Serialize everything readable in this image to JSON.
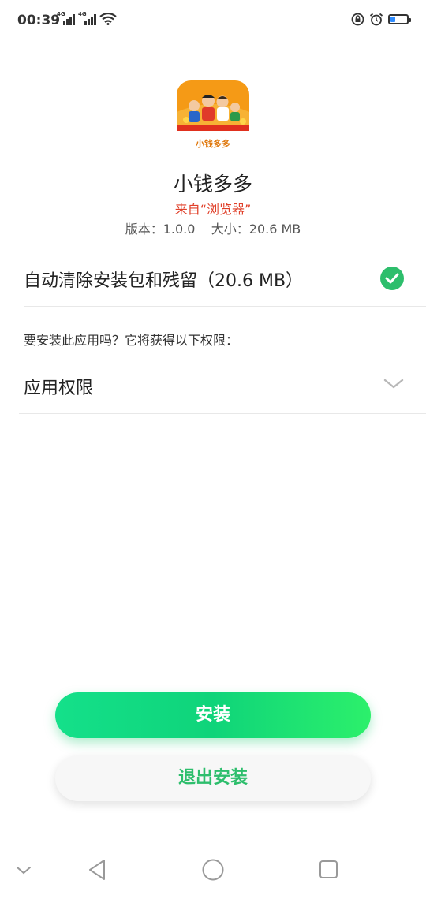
{
  "status_bar": {
    "time": "00:39",
    "network_1": "4G",
    "network_2": "4G",
    "battery_level": 0.3
  },
  "app": {
    "name": "小钱多多",
    "icon_text": "小钱多多",
    "source": "来自“浏览器”",
    "meta": "版本：1.0.0    大小：20.6 MB"
  },
  "options": {
    "auto_clean_label": "自动清除安装包和残留（20.6 MB）",
    "auto_clean_checked": true
  },
  "permissions": {
    "question": "要安装此应用吗？它将获得以下权限：",
    "section_label": "应用权限"
  },
  "buttons": {
    "install": "安装",
    "exit": "退出安装"
  },
  "colors": {
    "accent": "#2dbe6c",
    "source_text": "#e0402a",
    "install_button": "#14e08a"
  }
}
